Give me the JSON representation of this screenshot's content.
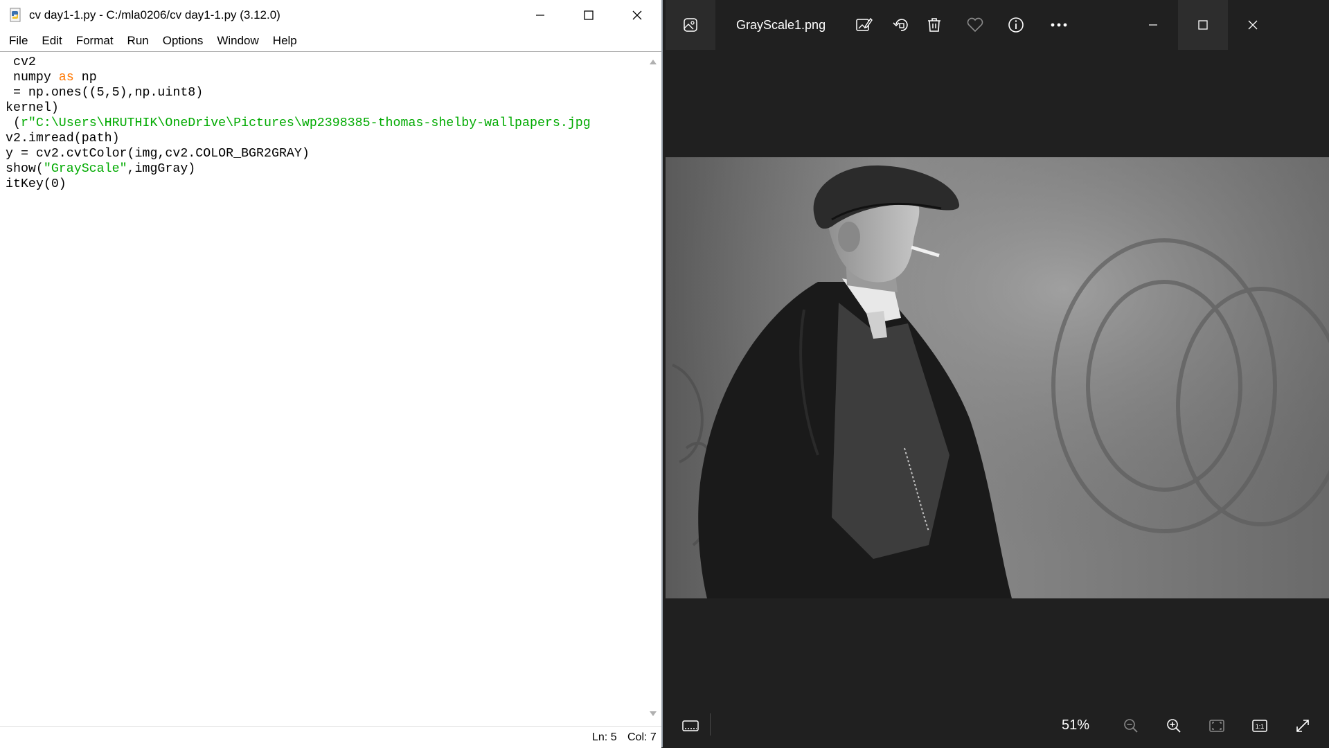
{
  "idle": {
    "title": "cv day1-1.py - C:/mla0206/cv day1-1.py (3.12.0)",
    "menu": [
      "File",
      "Edit",
      "Format",
      "Run",
      "Options",
      "Window",
      "Help"
    ],
    "code_lines": [
      [
        {
          "t": " cv2"
        }
      ],
      [
        {
          "t": " numpy "
        },
        {
          "t": "as",
          "c": "kw"
        },
        {
          "t": " np"
        }
      ],
      [
        {
          "t": " = np.ones((5,5),np.uint8)"
        }
      ],
      [
        {
          "t": "kernel)"
        }
      ],
      [
        {
          "t": " ("
        },
        {
          "t": "r\"C:\\Users\\HRUTHIK\\OneDrive\\Pictures\\wp2398385-thomas-shelby-wallpapers.jpg",
          "c": "str"
        }
      ],
      [
        {
          "t": "v2.imread(path)"
        }
      ],
      [
        {
          "t": "y = cv2.cvtColor(img,cv2.COLOR_BGR2GRAY)"
        }
      ],
      [
        {
          "t": "show("
        },
        {
          "t": "\"GrayScale\"",
          "c": "str"
        },
        {
          "t": ",imgGray)"
        }
      ],
      [
        {
          "t": "itKey(0)"
        }
      ]
    ],
    "status": {
      "line": "Ln: 5",
      "col": "Col: 7"
    }
  },
  "photos": {
    "filename": "GrayScale1.png",
    "zoom": "51%",
    "toolbar_icons": [
      "edit-image-icon",
      "rotate-icon",
      "delete-icon",
      "favorite-heart-icon",
      "info-icon",
      "more-icon"
    ]
  }
}
